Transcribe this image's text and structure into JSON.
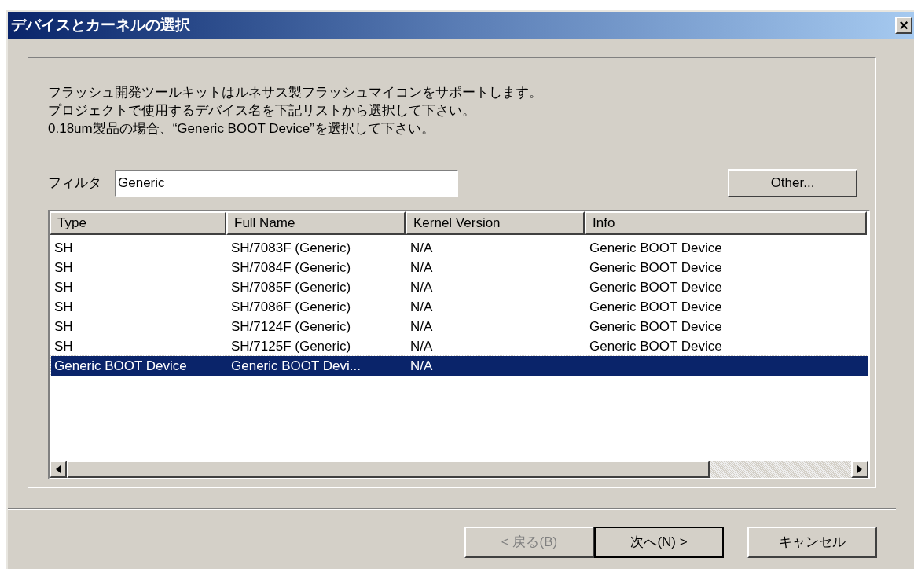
{
  "window": {
    "title": "デバイスとカーネルの選択",
    "close": "×"
  },
  "description": [
    "フラッシュ開発ツールキットはルネサス製フラッシュマイコンをサポートします。",
    "プロジェクトで使用するデバイス名を下記リストから選択して下さい。",
    "0.18um製品の場合、“Generic BOOT Device”を選択して下さい。"
  ],
  "filter": {
    "label": "フィルタ",
    "value": "Generic"
  },
  "other_button": "Other...",
  "table": {
    "columns": [
      "Type",
      "Full Name",
      "Kernel Version",
      "Info"
    ],
    "rows": [
      {
        "cells": [
          "SH",
          "SH/7083F (Generic)",
          "N/A",
          "Generic BOOT Device"
        ],
        "selected": false
      },
      {
        "cells": [
          "SH",
          "SH/7084F (Generic)",
          "N/A",
          "Generic BOOT Device"
        ],
        "selected": false
      },
      {
        "cells": [
          "SH",
          "SH/7085F (Generic)",
          "N/A",
          "Generic BOOT Device"
        ],
        "selected": false
      },
      {
        "cells": [
          "SH",
          "SH/7086F (Generic)",
          "N/A",
          "Generic BOOT Device"
        ],
        "selected": false
      },
      {
        "cells": [
          "SH",
          "SH/7124F (Generic)",
          "N/A",
          "Generic BOOT Device"
        ],
        "selected": false
      },
      {
        "cells": [
          "SH",
          "SH/7125F (Generic)",
          "N/A",
          "Generic BOOT Device"
        ],
        "selected": false
      },
      {
        "cells": [
          "Generic BOOT Device",
          "Generic BOOT Devi...",
          "N/A",
          ""
        ],
        "selected": true
      }
    ]
  },
  "buttons": [
    {
      "label": "< 戻る(B)",
      "disabled": true,
      "default": false
    },
    {
      "label": "次へ(N) >",
      "disabled": false,
      "default": true
    },
    {
      "label": "キャンセル",
      "disabled": false,
      "default": false
    }
  ]
}
